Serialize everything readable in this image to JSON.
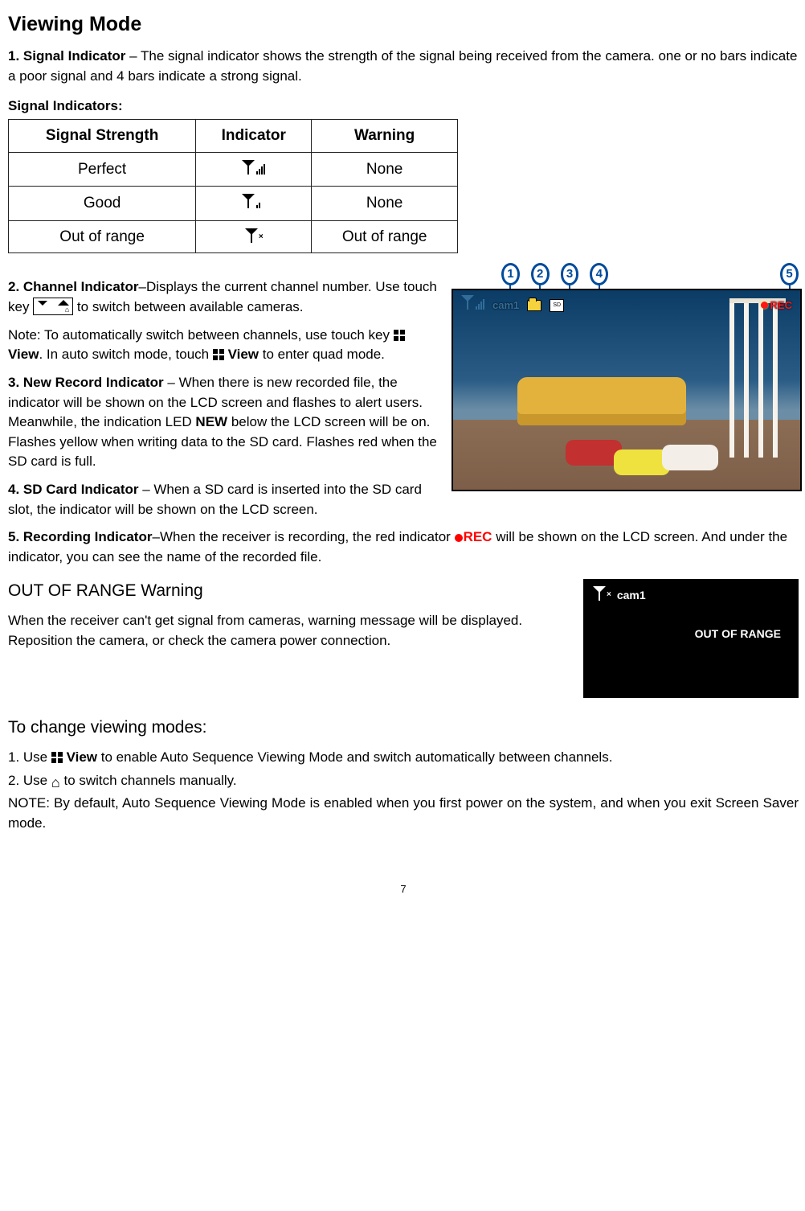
{
  "title": "Viewing Mode",
  "p1_pre": "1. Signal Indicator",
  "p1_body": " – The signal indicator shows the strength of the signal being received from the camera. one or no bars indicate a poor signal and 4 bars indicate a strong signal.",
  "sig_heading": "Signal Indicators:",
  "sig_table": {
    "headers": [
      "Signal Strength",
      "Indicator",
      "Warning"
    ],
    "rows": [
      {
        "strength": "Perfect",
        "warning": "None",
        "bars": 4
      },
      {
        "strength": "Good",
        "warning": "None",
        "bars": 2
      },
      {
        "strength": "Out of range",
        "warning": "Out of range",
        "bars": 0
      }
    ]
  },
  "p2_pre": "2. Channel Indicator",
  "p2_body_a": "–Displays the current channel number. Use touch key ",
  "p2_body_b": " to switch between available cameras.",
  "note_a": "Note: To automatically switch between channels, use touch key ",
  "view_lbl": "View",
  "note_b": ". In auto switch mode, touch ",
  "note_c": " to enter quad mode.",
  "p3_pre": "3. New Record Indicator",
  "p3_body_a": " – When there is new recorded file, the indicator will be shown on the LCD screen and flashes to alert users. Meanwhile, the indication LED ",
  "new_lbl": "NEW",
  "p3_body_b": " below the LCD screen will be on.",
  "p3_body_c": "Flashes yellow when writing data to the SD card. Flashes red when the SD card is full.",
  "p4_pre": "4. SD Card Indicator",
  "p4_body": " – When a SD card is inserted into the SD card slot, the indicator will be shown on the LCD screen.",
  "p5_pre": "5. Recording Indicator",
  "p5_body_a": "–When the receiver is recording, the red indicator ",
  "rec_lbl": "REC",
  "p5_body_b": " will be shown on the LCD screen. And under the indicator, you can see the name of the recorded file.",
  "oor_heading": "OUT OF RANGE Warning",
  "oor_body": "When the receiver can't get signal from cameras, warning message will be displayed. Reposition the camera, or check the camera power connection.",
  "change_heading": "To change viewing modes:",
  "step1_a": "1. Use ",
  "step1_b": " to enable Auto Sequence Viewing Mode and switch automatically between channels.",
  "step2_a": "2. Use ",
  "step2_b": " to switch channels manually.",
  "note2": "NOTE: By default, Auto Sequence Viewing Mode is enabled when you first power on the system, and when you exit Screen Saver mode.",
  "callouts": [
    "1",
    "2",
    "3",
    "4",
    "5"
  ],
  "hud": {
    "cam": "cam1",
    "sd": "SD",
    "rec": "REC"
  },
  "oor_box": {
    "cam": "cam1",
    "msg": "OUT OF RANGE"
  },
  "page_number": "7"
}
